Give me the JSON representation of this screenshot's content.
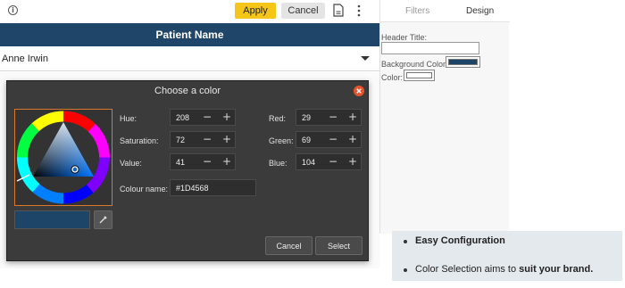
{
  "toolbar": {
    "apply_label": "Apply",
    "cancel_label": "Cancel",
    "apply_color": "#f5c518"
  },
  "grid": {
    "column_header": "Patient Name",
    "rows": [
      {
        "value": "Anne Irwin"
      }
    ],
    "header_color": "#1f4569"
  },
  "side_panel": {
    "tabs": [
      {
        "label": "Filters"
      },
      {
        "label": "Design"
      }
    ],
    "header_title_label": "Header Title:",
    "background_color_label": "Background Color:",
    "color_label": "Color:",
    "background_color_value": "#1D4568",
    "color_value": "#ffffff"
  },
  "dialog": {
    "title": "Choose a color",
    "hue_label": "Hue:",
    "hue_value": "208",
    "saturation_label": "Saturation:",
    "saturation_value": "72",
    "value_label": "Value:",
    "value_value": "41",
    "red_label": "Red:",
    "red_value": "29",
    "green_label": "Green:",
    "green_value": "69",
    "blue_label": "Blue:",
    "blue_value": "104",
    "colour_name_label": "Colour name:",
    "colour_name_value": "#1D4568",
    "minus_symbol": "−",
    "plus_symbol": "+",
    "cancel_label": "Cancel",
    "select_label": "Select",
    "selected_color": "#1D4568"
  },
  "callout": {
    "line1": "Easy Configuration",
    "line2_prefix": "Color Selection aims to ",
    "line2_bold": "suit your brand."
  },
  "icons": [
    "info-icon",
    "document-icon",
    "kebab-menu-icon",
    "dropdown-caret-icon",
    "close-icon",
    "color-wheel-icon",
    "pipette-icon"
  ]
}
